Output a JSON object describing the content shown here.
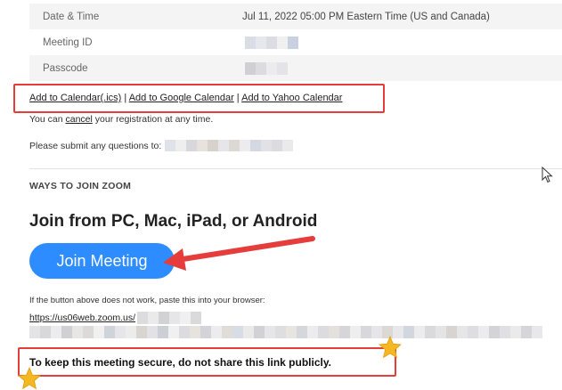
{
  "meeting_info": [
    {
      "label": "Date & Time",
      "value": "Jul 11, 2022 05:00 PM Eastern Time (US and Canada)"
    },
    {
      "label": "Meeting ID",
      "value": ""
    },
    {
      "label": "Passcode",
      "value": ""
    }
  ],
  "calendar": {
    "ics": "Add to Calendar(.ics)",
    "sep1": " | ",
    "google": "Add to Google Calendar",
    "sep2": " | ",
    "yahoo": "Add to Yahoo Calendar"
  },
  "cancel": {
    "prefix": "You can ",
    "link": "cancel",
    "suffix": " your registration at any time."
  },
  "questions": {
    "text": "Please submit any questions to:"
  },
  "ways": {
    "title": "WAYS TO JOIN ZOOM",
    "heading": "Join from PC, Mac, iPad, or Android",
    "button": "Join Meeting",
    "fallback": "If the button above does not work, paste this into your browser:",
    "url": "https://us06web.zoom.us/"
  },
  "security": {
    "text": "To keep this meeting secure, do not share this link publicly."
  },
  "colors": {
    "accent_blue": "#2d8cff",
    "highlight_red": "#e53c3c",
    "star_gold": "#f5b822"
  }
}
